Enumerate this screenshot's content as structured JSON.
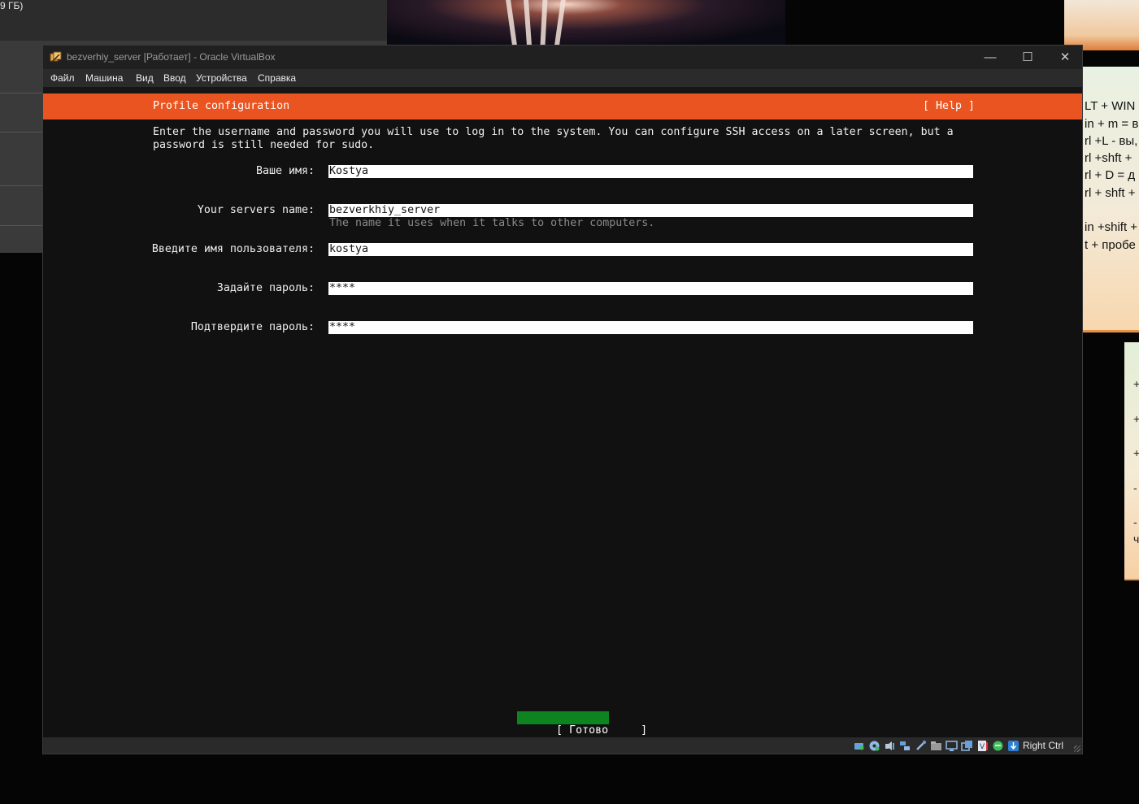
{
  "background": {
    "left_panel_size_text": "9 ГБ)",
    "sticky_note_lines": [
      "LT + WIN",
      "in + m = в",
      "rl +L - вы,",
      "rl +shft +",
      "rl + D = д",
      "rl + shft +",
      "",
      "in +shift +",
      "t + пробе"
    ],
    "sticky_note2_lines": [
      "+",
      "+",
      "+",
      "-",
      "-",
      "ч"
    ]
  },
  "window": {
    "title": "bezverhiy_server [Работает] - Oracle VirtualBox",
    "app_icon": "virtualbox-icon",
    "controls": {
      "minimize": "—",
      "maximize": "☐",
      "close": "✕"
    }
  },
  "menu": {
    "items": [
      "Файл",
      "Машина",
      "Вид",
      "Ввод",
      "Устройства",
      "Справка"
    ]
  },
  "installer": {
    "header_title": "Profile configuration",
    "help_label": "[ Help ]",
    "intro_text": "Enter the username and password you will use to log in to the system. You can configure SSH access on a later screen, but a\npassword is still needed for sudo.",
    "fields": [
      {
        "label": "Ваше имя:",
        "value": "Kostya",
        "hint": ""
      },
      {
        "label": "Your servers name:",
        "value": "bezverkhiy_server",
        "hint": "The name it uses when it talks to other computers."
      },
      {
        "label": "Введите имя пользователя:",
        "value": "kostya",
        "hint": ""
      },
      {
        "label": "Задайте пароль:",
        "value": "****",
        "hint": ""
      },
      {
        "label": "Подтвердите пароль:",
        "value": "****",
        "hint": ""
      }
    ],
    "done_label": "[ Готово     ]"
  },
  "statusbar": {
    "icons": [
      "hard-disk-icon",
      "optical-drive-icon",
      "audio-icon",
      "network-icon",
      "usb-icon",
      "shared-folders-icon",
      "display-icon",
      "capture-icon",
      "video-recording-icon",
      "mouse-integration-icon",
      "keyboard-capture-icon"
    ],
    "host_key": "Right Ctrl"
  },
  "colors": {
    "accent_orange": "#e95420",
    "done_green": "#0e8420",
    "screen_bg": "#111111"
  }
}
